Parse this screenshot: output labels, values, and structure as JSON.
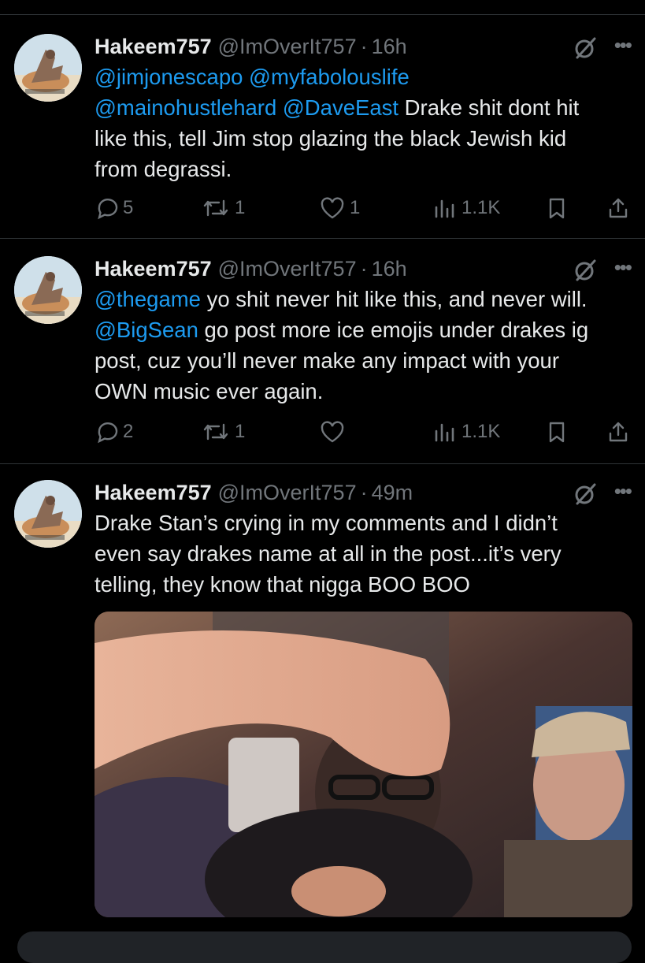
{
  "tweets": [
    {
      "name": "Hakeem757",
      "handle": "@ImOverIt757",
      "time": "16h",
      "mentions1": "@jimjonescapo @myfabolouslife",
      "mentions2": "@mainohustlehard @DaveEast",
      "text_a": " Drake shit dont hit",
      "text_b": "like this, tell Jim stop glazing the black Jewish kid",
      "text_c": "from degrassi.",
      "replies": "5",
      "reposts": "1",
      "likes": "1",
      "views": "1.1K"
    },
    {
      "name": "Hakeem757",
      "handle": "@ImOverIt757",
      "time": "16h",
      "mention_a": "@thegame",
      "text_a": " yo shit never hit like this, and never will.",
      "mention_b": "@BigSean",
      "text_b": " go post more ice emojis under drakes ig",
      "text_c": "post, cuz you’ll never make any impact with your",
      "text_d": "OWN music ever again.",
      "replies": "2",
      "reposts": "1",
      "likes": "",
      "views": "1.1K"
    },
    {
      "name": "Hakeem757",
      "handle": "@ImOverIt757",
      "time": "49m",
      "text_a": "Drake Stan’s crying in my comments and I didn’t",
      "text_b": "even say drakes name at all in the post...it’s very",
      "text_c": "telling, they know that nigga BOO BOO"
    }
  ],
  "icons": {
    "reply": "reply-icon",
    "repost": "repost-icon",
    "like": "heart-icon",
    "views": "views-icon",
    "bookmark": "bookmark-icon",
    "share": "share-icon",
    "grok": "grok-icon",
    "more": "more-icon"
  },
  "colors": {
    "background": "#000000",
    "text": "#e7e9ea",
    "secondary": "#71767b",
    "link": "#1d9bf0",
    "divider": "#2f3336"
  }
}
